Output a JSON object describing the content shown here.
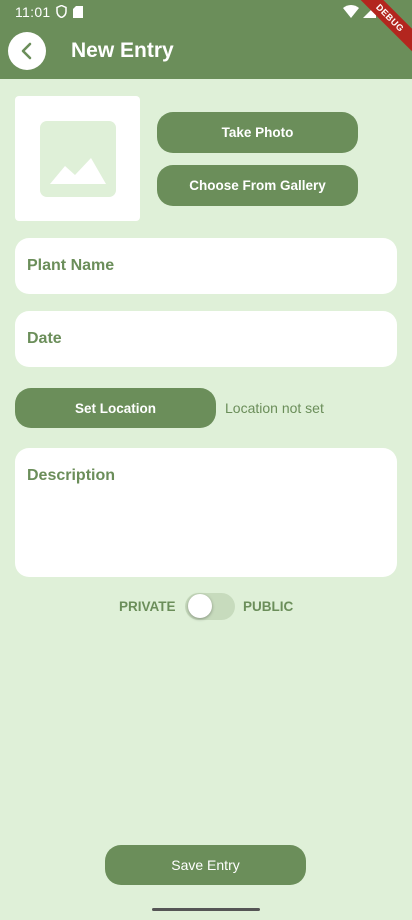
{
  "status_bar": {
    "time": "11:01",
    "icons": [
      "shield-icon",
      "sd-card-icon",
      "wifi-icon",
      "signal-icon",
      "battery-icon"
    ]
  },
  "app_bar": {
    "title": "New Entry",
    "back_icon": "chevron-left-icon",
    "debug_label": "DEBUG"
  },
  "photo": {
    "placeholder_icon": "image-placeholder-icon",
    "take_photo_label": "Take Photo",
    "gallery_label": "Choose From Gallery"
  },
  "form": {
    "plant_name_placeholder": "Plant Name",
    "date_placeholder": "Date",
    "set_location_label": "Set Location",
    "location_status": "Location not set",
    "description_placeholder": "Description"
  },
  "privacy": {
    "private_label": "PRIVATE",
    "public_label": "PUBLIC",
    "is_public": false
  },
  "actions": {
    "save_label": "Save Entry"
  },
  "colors": {
    "primary": "#6b8e5a",
    "background": "#dff0d8",
    "surface": "#ffffff"
  }
}
